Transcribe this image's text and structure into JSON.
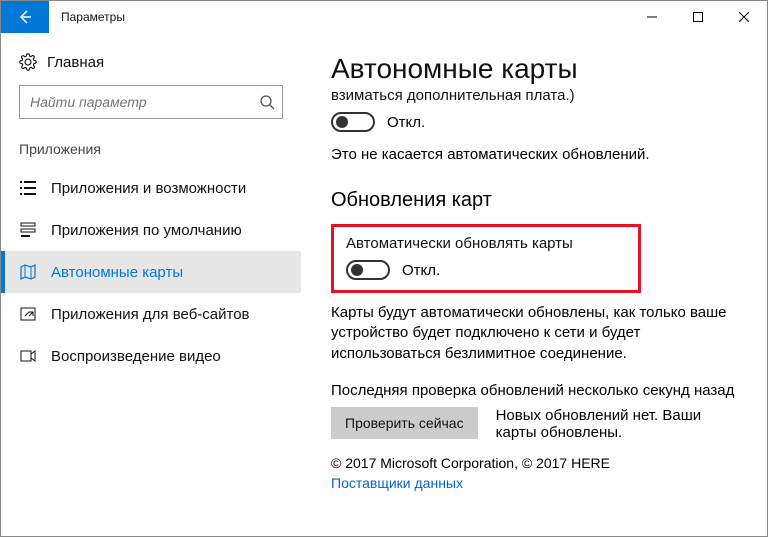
{
  "window": {
    "title": "Параметры"
  },
  "sidebar": {
    "home": "Главная",
    "search_placeholder": "Найти параметр",
    "section": "Приложения",
    "items": [
      {
        "label": "Приложения и возможности"
      },
      {
        "label": "Приложения по умолчанию"
      },
      {
        "label": "Автономные карты"
      },
      {
        "label": "Приложения для веб-сайтов"
      },
      {
        "label": "Воспроизведение видео"
      }
    ]
  },
  "content": {
    "title": "Автономные карты",
    "fee_note": "взиматься дополнительная плата.)",
    "toggle1_state": "Откл.",
    "auto_note": "Это не касается автоматических обновлений.",
    "section2": "Обновления карт",
    "auto_update_label": "Автоматически обновлять карты",
    "toggle2_state": "Откл.",
    "update_desc": "Карты будут автоматически обновлены, как только ваше устройство будет подключено к сети и будет использоваться безлимитное соединение.",
    "last_check": "Последняя проверка обновлений несколько секунд назад",
    "check_btn": "Проверить сейчас",
    "check_status": "Новых обновлений нет. Ваши карты обновлены.",
    "copyright": "© 2017 Microsoft Corporation, © 2017 HERE",
    "providers_link": "Поставщики данных"
  }
}
